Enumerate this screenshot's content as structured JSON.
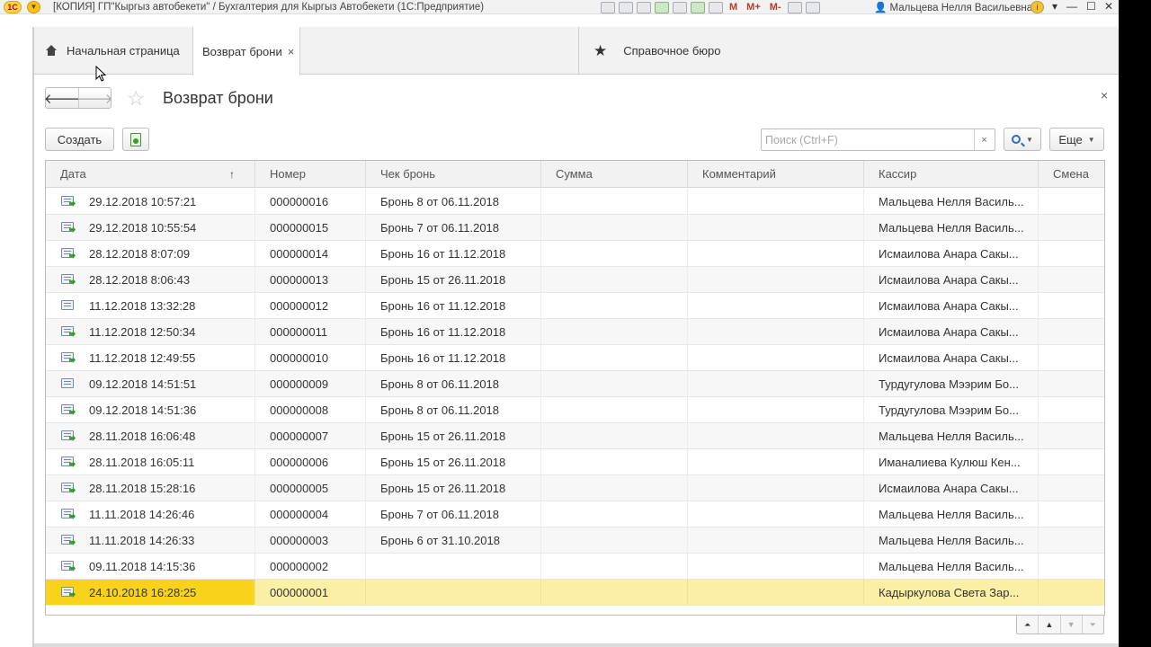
{
  "window": {
    "title": "[КОПИЯ] ГП\"Кыргыз автобекети\" / Бухгалтерия для Кыргыз Автобекети  (1С:Предприятие)",
    "logo_text": "1С",
    "user": "Мальцева Нелля Васильевна",
    "toolbar_m_labels": [
      "M",
      "M+",
      "M-"
    ],
    "minimize": "—",
    "maximize": "☐",
    "close": "✕"
  },
  "tabs": {
    "home_label": "Начальная страница",
    "active_label": "Возврат брони",
    "active_close": "×",
    "reference_label": "Справочное бюро"
  },
  "form": {
    "title": "Возврат брони",
    "back": "🡐",
    "forward": "🡒",
    "close": "×"
  },
  "toolbar": {
    "create_label": "Создать",
    "search_placeholder": "Поиск (Ctrl+F)",
    "search_clear": "×",
    "more_label": "Еще"
  },
  "table": {
    "columns": [
      "Дата",
      "Номер",
      "Чек бронь",
      "Сумма",
      "Комментарий",
      "Кассир",
      "Смена"
    ],
    "sort_indicator": "↑",
    "rows": [
      {
        "date": "29.12.2018 10:57:21",
        "number": "000000016",
        "check": "Бронь 8 от 06.11.2018",
        "sum": "",
        "comment": "",
        "cashier": "Мальцева Нелля Василь...",
        "shift": "",
        "posted": true
      },
      {
        "date": "29.12.2018 10:55:54",
        "number": "000000015",
        "check": "Бронь 7 от 06.11.2018",
        "sum": "",
        "comment": "",
        "cashier": "Мальцева Нелля Василь...",
        "shift": "",
        "posted": true
      },
      {
        "date": "28.12.2018 8:07:09",
        "number": "000000014",
        "check": "Бронь 16 от 11.12.2018",
        "sum": "",
        "comment": "",
        "cashier": "Исмаилова Анара Сакы...",
        "shift": "",
        "posted": true
      },
      {
        "date": "28.12.2018 8:06:43",
        "number": "000000013",
        "check": "Бронь 15 от 26.11.2018",
        "sum": "",
        "comment": "",
        "cashier": "Исмаилова Анара Сакы...",
        "shift": "",
        "posted": true
      },
      {
        "date": "11.12.2018 13:32:28",
        "number": "000000012",
        "check": "Бронь 16 от 11.12.2018",
        "sum": "",
        "comment": "",
        "cashier": "Исмаилова Анара Сакы...",
        "shift": "",
        "posted": false
      },
      {
        "date": "11.12.2018 12:50:34",
        "number": "000000011",
        "check": "Бронь 16 от 11.12.2018",
        "sum": "",
        "comment": "",
        "cashier": "Исмаилова Анара Сакы...",
        "shift": "",
        "posted": true
      },
      {
        "date": "11.12.2018 12:49:55",
        "number": "000000010",
        "check": "Бронь 16 от 11.12.2018",
        "sum": "",
        "comment": "",
        "cashier": "Исмаилова Анара Сакы...",
        "shift": "",
        "posted": true
      },
      {
        "date": "09.12.2018 14:51:51",
        "number": "000000009",
        "check": "Бронь 8 от 06.11.2018",
        "sum": "",
        "comment": "",
        "cashier": "Турдугулова Мээрим Бо...",
        "shift": "",
        "posted": false
      },
      {
        "date": "09.12.2018 14:51:36",
        "number": "000000008",
        "check": "Бронь 8 от 06.11.2018",
        "sum": "",
        "comment": "",
        "cashier": "Турдугулова Мээрим Бо...",
        "shift": "",
        "posted": true
      },
      {
        "date": "28.11.2018 16:06:48",
        "number": "000000007",
        "check": "Бронь 15 от 26.11.2018",
        "sum": "",
        "comment": "",
        "cashier": "Мальцева Нелля Василь...",
        "shift": "",
        "posted": true
      },
      {
        "date": "28.11.2018 16:05:11",
        "number": "000000006",
        "check": "Бронь 15 от 26.11.2018",
        "sum": "",
        "comment": "",
        "cashier": "Иманалиева Кулюш Кен...",
        "shift": "",
        "posted": true
      },
      {
        "date": "28.11.2018 15:28:16",
        "number": "000000005",
        "check": "Бронь 15 от 26.11.2018",
        "sum": "",
        "comment": "",
        "cashier": "Исмаилова Анара Сакы...",
        "shift": "",
        "posted": true
      },
      {
        "date": "11.11.2018 14:26:46",
        "number": "000000004",
        "check": "Бронь 7 от 06.11.2018",
        "sum": "",
        "comment": "",
        "cashier": "Мальцева Нелля Василь...",
        "shift": "",
        "posted": true
      },
      {
        "date": "11.11.2018 14:26:33",
        "number": "000000003",
        "check": "Бронь 6 от 31.10.2018",
        "sum": "",
        "comment": "",
        "cashier": "Мальцева Нелля Василь...",
        "shift": "",
        "posted": true
      },
      {
        "date": "09.11.2018 14:15:36",
        "number": "000000002",
        "check": "",
        "sum": "",
        "comment": "",
        "cashier": "Мальцева Нелля Василь...",
        "shift": "",
        "posted": true
      },
      {
        "date": "24.10.2018 16:28:25",
        "number": "000000001",
        "check": "",
        "sum": "",
        "comment": "",
        "cashier": "Кадыркулова Света Зар...",
        "shift": "",
        "posted": true,
        "selected": true
      }
    ]
  },
  "colors": {
    "selected_row": "#fbefa6",
    "selected_cell": "#f8d21b",
    "posted_icon": "#2f9a2a"
  }
}
